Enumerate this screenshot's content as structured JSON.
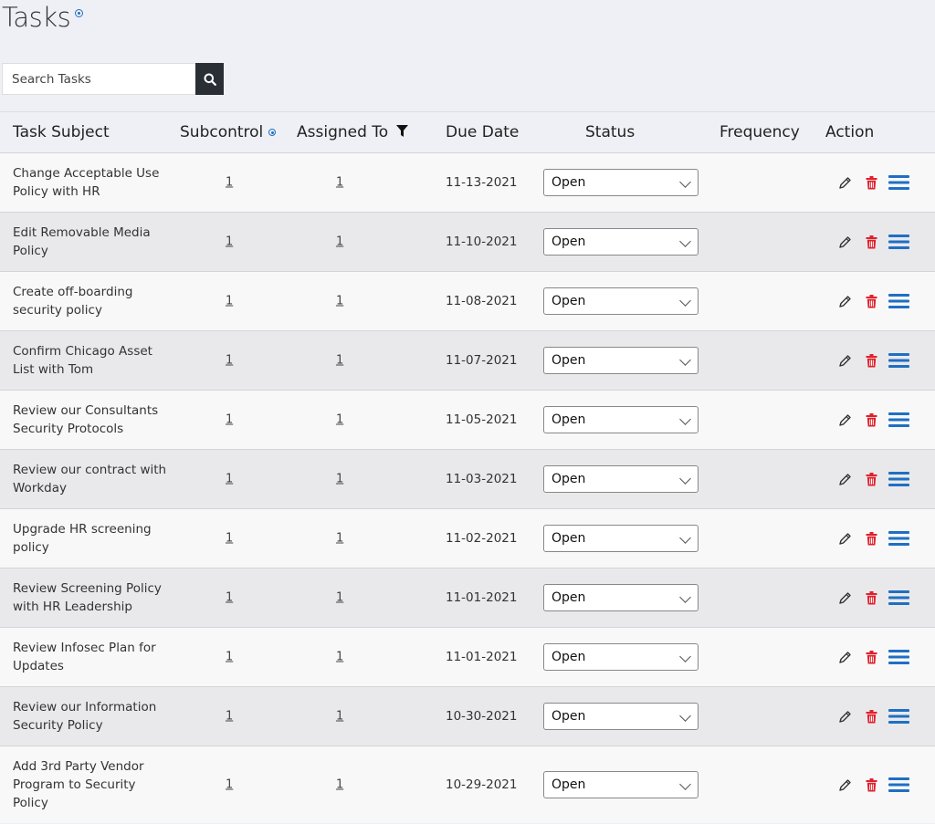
{
  "page": {
    "title": "Tasks"
  },
  "search": {
    "placeholder": "Search Tasks"
  },
  "columns": {
    "subject": "Task Subject",
    "subcontrol": "Subcontrol",
    "assigned": "Assigned To",
    "due": "Due Date",
    "status": "Status",
    "frequency": "Frequency",
    "action": "Action"
  },
  "colors": {
    "delete": "#e0202b",
    "menu": "#1f6fc3",
    "search_button": "#2a2f36"
  },
  "rows": [
    {
      "subject": "Change Acceptable Use Policy with HR",
      "subcontrol": "1",
      "assigned": "1",
      "due": "11-13-2021",
      "status": "Open",
      "frequency": ""
    },
    {
      "subject": "Edit Removable Media Policy",
      "subcontrol": "1",
      "assigned": "1",
      "due": "11-10-2021",
      "status": "Open",
      "frequency": ""
    },
    {
      "subject": "Create off-boarding security policy",
      "subcontrol": "1",
      "assigned": "1",
      "due": "11-08-2021",
      "status": "Open",
      "frequency": ""
    },
    {
      "subject": "Confirm Chicago Asset List with Tom",
      "subcontrol": "1",
      "assigned": "1",
      "due": "11-07-2021",
      "status": "Open",
      "frequency": ""
    },
    {
      "subject": "Review our Consultants Security Protocols",
      "subcontrol": "1",
      "assigned": "1",
      "due": "11-05-2021",
      "status": "Open",
      "frequency": ""
    },
    {
      "subject": "Review our contract with Workday",
      "subcontrol": "1",
      "assigned": "1",
      "due": "11-03-2021",
      "status": "Open",
      "frequency": ""
    },
    {
      "subject": "Upgrade HR screening policy",
      "subcontrol": "1",
      "assigned": "1",
      "due": "11-02-2021",
      "status": "Open",
      "frequency": ""
    },
    {
      "subject": "Review Screening Policy with HR Leadership",
      "subcontrol": "1",
      "assigned": "1",
      "due": "11-01-2021",
      "status": "Open",
      "frequency": ""
    },
    {
      "subject": "Review Infosec Plan for Updates",
      "subcontrol": "1",
      "assigned": "1",
      "due": "11-01-2021",
      "status": "Open",
      "frequency": ""
    },
    {
      "subject": "Review our Information Security Policy",
      "subcontrol": "1",
      "assigned": "1",
      "due": "10-30-2021",
      "status": "Open",
      "frequency": ""
    },
    {
      "subject": "Add 3rd Party Vendor Program to Security Policy",
      "subcontrol": "1",
      "assigned": "1",
      "due": "10-29-2021",
      "status": "Open",
      "frequency": ""
    }
  ]
}
